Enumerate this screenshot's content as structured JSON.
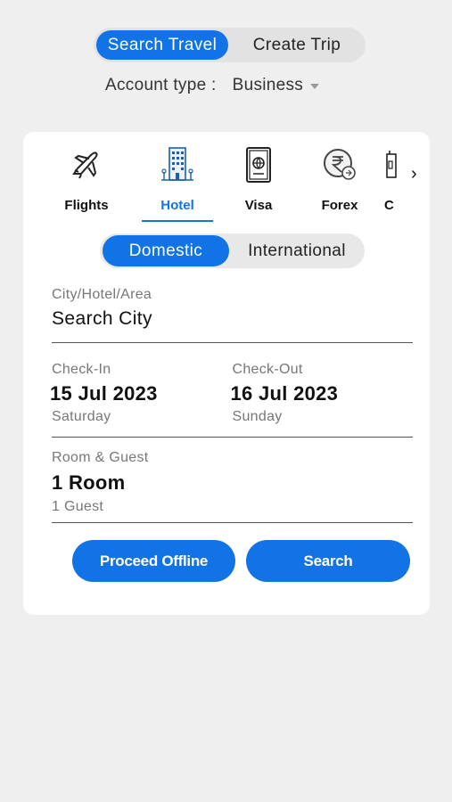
{
  "top_toggle": {
    "search_travel": "Search Travel",
    "create_trip": "Create Trip"
  },
  "account": {
    "label": "Account type :",
    "value": "Business"
  },
  "services": [
    {
      "label": "Flights",
      "icon": "airplane-icon"
    },
    {
      "label": "Hotel",
      "icon": "hotel-building-icon"
    },
    {
      "label": "Visa",
      "icon": "passport-icon"
    },
    {
      "label": "Forex",
      "icon": "rupee-exchange-icon"
    },
    {
      "label": "C",
      "icon": "partial-service-icon"
    }
  ],
  "hotel_type": {
    "domestic": "Domestic",
    "international": "International"
  },
  "city": {
    "label": "City/Hotel/Area",
    "placeholder": "Search City"
  },
  "check_in": {
    "label": "Check-In",
    "date": "15 Jul 2023",
    "day": "Saturday"
  },
  "check_out": {
    "label": "Check-Out",
    "date": "16 Jul 2023",
    "day": "Sunday"
  },
  "room_guest": {
    "label": "Room & Guest",
    "rooms": "1 Room",
    "guests": "1 Guest"
  },
  "buttons": {
    "proceed_offline": "Proceed Offline",
    "search": "Search"
  },
  "colors": {
    "accent": "#1273e6",
    "background": "#efefef",
    "card": "#ffffff"
  }
}
